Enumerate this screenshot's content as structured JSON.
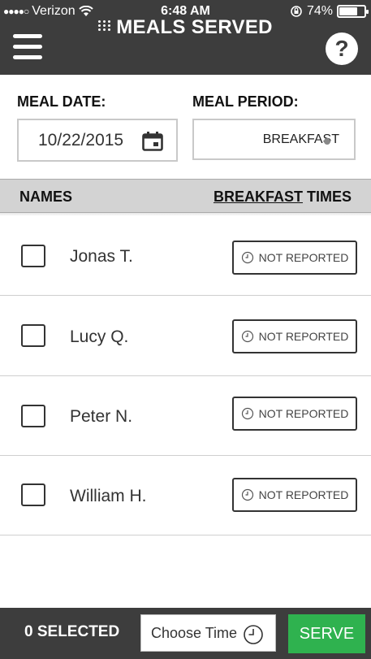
{
  "status_bar": {
    "carrier": "Verizon",
    "time": "6:48 AM",
    "battery": "74%",
    "battery_level": 0.74
  },
  "header": {
    "title": "MEALS SERVED",
    "menu_icon": "hamburger-menu-icon",
    "help_label": "?"
  },
  "form": {
    "meal_date_label": "MEAL DATE:",
    "meal_date_value": "10/22/2015",
    "meal_period_label": "MEAL PERIOD:",
    "meal_period_value": "BREAKFAST"
  },
  "table": {
    "names_header": "NAMES",
    "times_header_period": "BREAKFAST",
    "times_header_suffix": " TIMES",
    "rows": [
      {
        "name": "Jonas T.",
        "status": "NOT REPORTED",
        "checked": false
      },
      {
        "name": "Lucy Q.",
        "status": "NOT REPORTED",
        "checked": false
      },
      {
        "name": "Peter N.",
        "status": "NOT REPORTED",
        "checked": false
      },
      {
        "name": "William H.",
        "status": "NOT REPORTED",
        "checked": false
      }
    ]
  },
  "footer": {
    "selected_count": "0 SELECTED",
    "time_placeholder": "Choose Time",
    "serve_label": "SERVE"
  },
  "colors": {
    "header_bg": "#3d3d3d",
    "table_head_bg": "#d3d3d3",
    "serve_green": "#2fb24f"
  }
}
